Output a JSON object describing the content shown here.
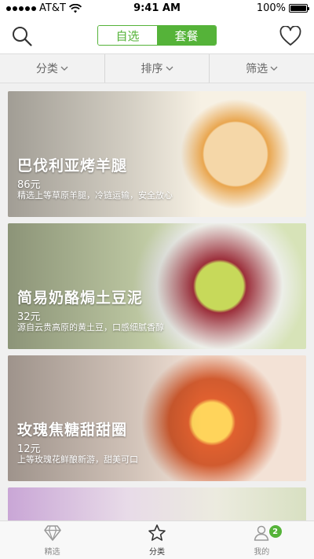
{
  "status_bar": {
    "carrier": "AT&T",
    "time": "9:41 AM",
    "battery": "100%",
    "icons": [
      "signal-dots-icon",
      "wifi-icon",
      "battery-icon"
    ]
  },
  "nav": {
    "segments": [
      {
        "label": "自选",
        "active": false
      },
      {
        "label": "套餐",
        "active": true
      }
    ],
    "icons": [
      "search-icon",
      "heart-icon"
    ]
  },
  "filters": [
    {
      "label": "分类"
    },
    {
      "label": "排序"
    },
    {
      "label": "筛选"
    }
  ],
  "cards": [
    {
      "title": "巴伐利亚烤羊腿",
      "price": "86元",
      "desc": "精选上等草原羊腿，冷链运输，安全放心"
    },
    {
      "title": "简易奶酪焗土豆泥",
      "price": "32元",
      "desc": "源自云贵高原的黄土豆，口感细腻香醇"
    },
    {
      "title": "玫瑰焦糖甜甜圈",
      "price": "12元",
      "desc": "上等玫瑰花鲜酿新游，甜美可口"
    },
    {
      "title": "",
      "price": "",
      "desc": ""
    }
  ],
  "tabs": [
    {
      "label": "精选",
      "icon": "diamond-icon",
      "active": false
    },
    {
      "label": "分类",
      "icon": "star-icon",
      "active": true
    },
    {
      "label": "我的",
      "icon": "user-icon",
      "active": false,
      "badge": "2"
    }
  ],
  "colors": {
    "accent": "#55b339",
    "filter_bg": "#f2f2f2"
  }
}
